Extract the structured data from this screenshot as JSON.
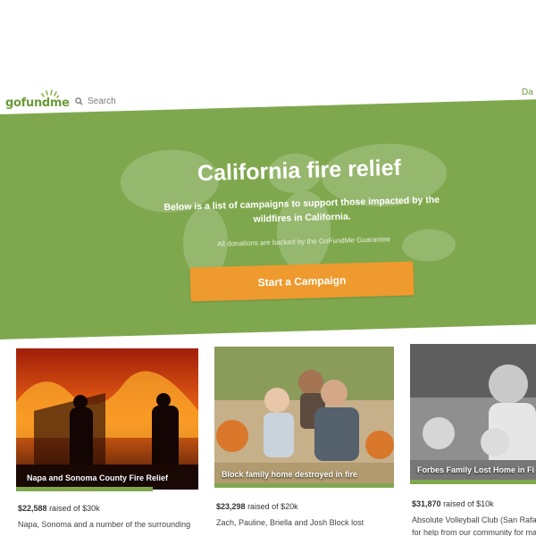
{
  "header": {
    "logo_text": "gofundme",
    "search_label": "Search",
    "nav_right": "Da"
  },
  "hero": {
    "title": "California fire relief",
    "subtitle": "Below is a list of campaigns to support those impacted by the wildfires in California.",
    "guarantee_note": "All donations are backed by the GoFundMe Guarantee",
    "cta_label": "Start a Campaign",
    "background_color": "#7fa84e",
    "cta_color": "#ee9a2e"
  },
  "campaigns": [
    {
      "title": "Napa and Sonoma County Fire Relief",
      "raised_amount": "$22,588",
      "raised_word": "raised",
      "goal": "of $30k",
      "description": "Napa, Sonoma and a number of the surrounding",
      "progress": 0.75
    },
    {
      "title": "Block family home destroyed in fire",
      "raised_amount": "$23,298",
      "raised_word": "raised",
      "goal": "of $20k",
      "description": "Zach, Pauline, Briella and Josh Block lost",
      "progress": 1.0
    },
    {
      "title": "Forbes Family Lost Home in Fi",
      "raised_amount": "$31,870",
      "raised_word": "raised",
      "goal": "of $10k",
      "description": "Absolute Volleyball Club (San Rafae",
      "description2": "for help from our community for ma",
      "progress": 1.0
    }
  ]
}
